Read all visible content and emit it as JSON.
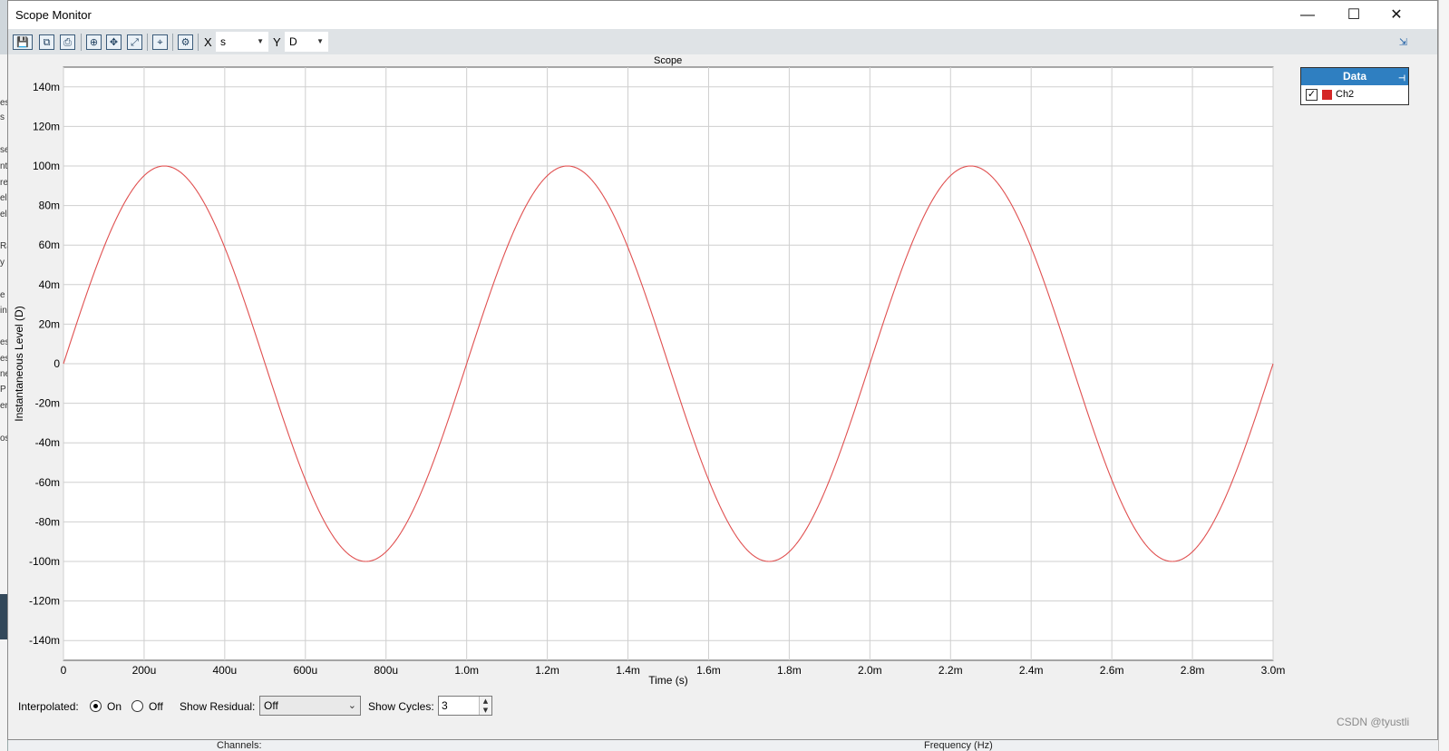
{
  "window": {
    "title": "Scope Monitor",
    "minimize_glyph": "—",
    "maximize_glyph": "☐",
    "close_glyph": "✕"
  },
  "toolbar": {
    "icons": [
      "save-icon",
      "save-as-icon",
      "print-icon",
      "zoom-icon",
      "pan-icon",
      "fit-icon",
      "cursor-icon",
      "settings-icon",
      "export-icon"
    ],
    "x_label": "X",
    "x_unit": "s",
    "y_label": "Y",
    "y_unit": "D"
  },
  "legend": {
    "header": "Data",
    "items": [
      {
        "label": "Ch2",
        "checked": true,
        "color": "#d42626"
      }
    ]
  },
  "chart_data": {
    "type": "line",
    "title": "Scope",
    "xlabel": "Time (s)",
    "ylabel": "Instantaneous Level (D)",
    "xlim": [
      0,
      0.003
    ],
    "ylim": [
      -0.15,
      0.15
    ],
    "x_ticks": [
      0,
      0.0002,
      0.0004,
      0.0006,
      0.0008,
      0.001,
      0.0012,
      0.0014,
      0.0016,
      0.0018,
      0.002,
      0.0022,
      0.0024,
      0.0026,
      0.0028,
      0.003
    ],
    "x_tick_labels": [
      "0",
      "200u",
      "400u",
      "600u",
      "800u",
      "1.0m",
      "1.2m",
      "1.4m",
      "1.6m",
      "1.8m",
      "2.0m",
      "2.2m",
      "2.4m",
      "2.6m",
      "2.8m",
      "3.0m"
    ],
    "y_ticks": [
      0.14,
      0.12,
      0.1,
      0.08,
      0.06,
      0.04,
      0.02,
      0,
      -0.02,
      -0.04,
      -0.06,
      -0.08,
      -0.1,
      -0.12,
      -0.14
    ],
    "y_tick_labels": [
      "140m",
      "120m",
      "100m",
      "80m",
      "60m",
      "40m",
      "20m",
      "0",
      "-20m",
      "-40m",
      "-60m",
      "-80m",
      "-100m",
      "-120m",
      "-140m"
    ],
    "grid": true,
    "series": [
      {
        "name": "Ch2",
        "color": "#e05050",
        "waveform": "sine",
        "amplitude": 0.1,
        "frequency_hz": 1000,
        "phase_deg": 0
      }
    ]
  },
  "controls": {
    "interpolated_label": "Interpolated:",
    "on_label": "On",
    "off_label": "Off",
    "interpolated_on": true,
    "residual_label": "Show Residual:",
    "residual_value": "Off",
    "cycles_label": "Show Cycles:",
    "cycles_value": "3"
  },
  "background": {
    "left_fragments": [
      "es",
      "s",
      "se",
      "nt",
      "re",
      "el",
      "el",
      "Ra",
      "y",
      "e",
      "in",
      "es",
      "es",
      "ne",
      "P",
      "er",
      "os"
    ],
    "channels_label": "Channels:",
    "frequency_label": "Frequency (Hz)",
    "watermark": "CSDN @tyustli"
  }
}
